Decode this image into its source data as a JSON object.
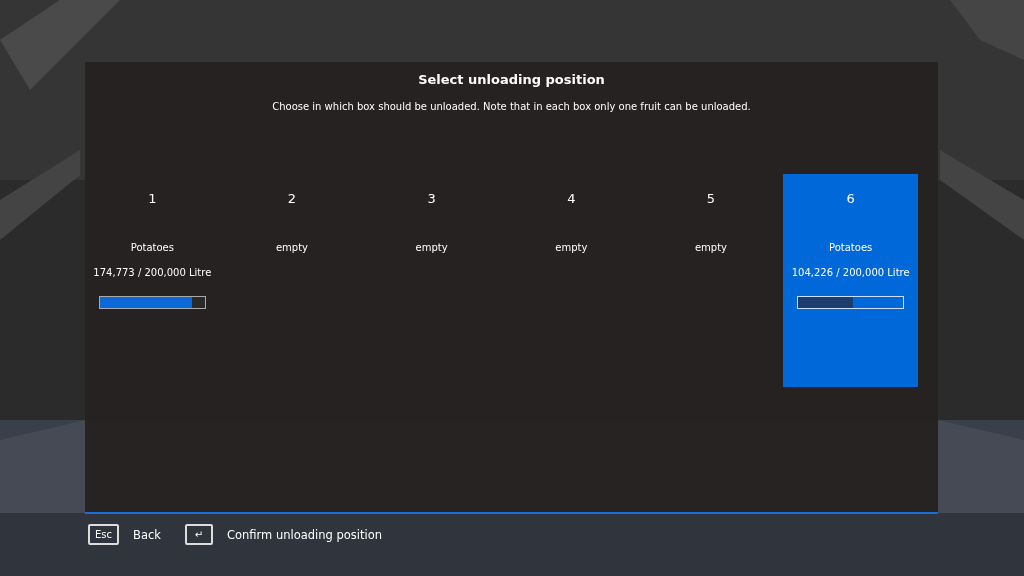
{
  "dialog": {
    "title": "Select unloading position",
    "description": "Choose in which box should be unloaded. Note that in each box only one fruit can be unloaded."
  },
  "boxes": [
    {
      "number": "1",
      "fruit": "Potatoes",
      "amount": "174,773 / 200,000 Litre",
      "level": 0.874,
      "selected": false
    },
    {
      "number": "2",
      "fruit": "empty",
      "selected": false
    },
    {
      "number": "3",
      "fruit": "empty",
      "selected": false
    },
    {
      "number": "4",
      "fruit": "empty",
      "selected": false
    },
    {
      "number": "5",
      "fruit": "empty",
      "selected": false
    },
    {
      "number": "6",
      "fruit": "Potatoes",
      "amount": "104,226 / 200,000 Litre",
      "level": 0.521,
      "selected": true
    }
  ],
  "footer": [
    {
      "key": "Esc",
      "label": "Back"
    },
    {
      "key": "↵",
      "label": "Confirm unloading position"
    }
  ]
}
